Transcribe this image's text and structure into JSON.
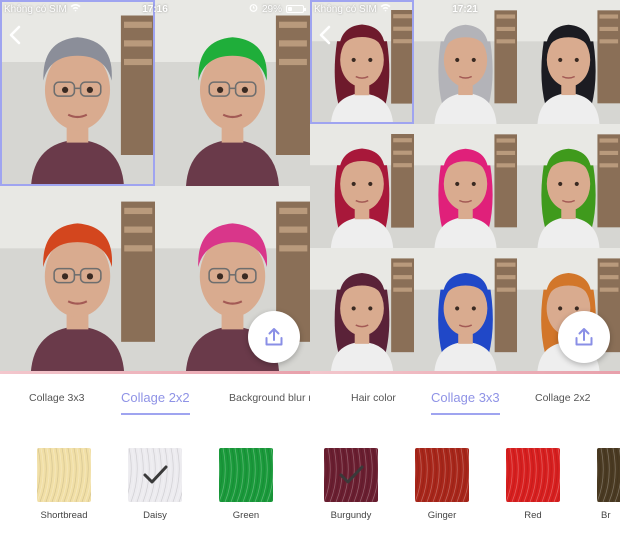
{
  "left": {
    "status": {
      "carrier": "Không có SIM",
      "time": "17:16",
      "battery": "29%",
      "battery_level": 0.29
    },
    "tabs": [
      {
        "label": "Collage 3x3",
        "active": false
      },
      {
        "label": "Collage 2x2",
        "active": true
      },
      {
        "label": "Background blur r",
        "active": false
      }
    ],
    "cells": [
      {
        "hair_color": "#8b8e99",
        "selected": true
      },
      {
        "hair_color": "#1fae3a",
        "selected": false
      },
      {
        "hair_color": "#d3461e",
        "selected": false
      },
      {
        "hair_color": "#d9368a",
        "selected": false
      }
    ],
    "swatches": [
      {
        "label": "Shortbread",
        "color": "#f1dfa6",
        "selected": false
      },
      {
        "label": "Daisy",
        "color": "#ecebef",
        "selected": true
      },
      {
        "label": "Green",
        "color": "#1a9a3b",
        "selected": false
      }
    ]
  },
  "right": {
    "status": {
      "carrier": "Không có SIM",
      "time": "17:21",
      "battery_level": 0.29
    },
    "tabs": [
      {
        "label": "Hair color",
        "active": false
      },
      {
        "label": "Collage 3x3",
        "active": true
      },
      {
        "label": "Collage 2x2",
        "active": false
      }
    ],
    "cells": [
      {
        "hair_color": "#6e1a2c",
        "selected": true
      },
      {
        "hair_color": "#b3b3b8",
        "selected": false
      },
      {
        "hair_color": "#1c1c22",
        "selected": false
      },
      {
        "hair_color": "#a8183a",
        "selected": false
      },
      {
        "hair_color": "#e0207a",
        "selected": false
      },
      {
        "hair_color": "#3f9a1c",
        "selected": false
      },
      {
        "hair_color": "#5a2238",
        "selected": false
      },
      {
        "hair_color": "#2048c8",
        "selected": false
      },
      {
        "hair_color": "#d2762a",
        "selected": false
      }
    ],
    "swatches": [
      {
        "label": "Burgundy",
        "color": "#6a1e30",
        "selected": true
      },
      {
        "label": "Ginger",
        "color": "#a8261a",
        "selected": false
      },
      {
        "label": "Red",
        "color": "#d81f1f",
        "selected": false
      },
      {
        "label": "Br",
        "color": "#4a3a22",
        "selected": false
      }
    ]
  },
  "icons": {
    "back": "chevron-left-icon",
    "upload": "share-upload-icon",
    "wifi": "wifi-icon",
    "alarm": "alarm-icon",
    "battery": "battery-icon",
    "check": "checkmark-icon"
  },
  "colors": {
    "accent": "#9fa4f0",
    "upload_icon": "#8a8fe6"
  }
}
